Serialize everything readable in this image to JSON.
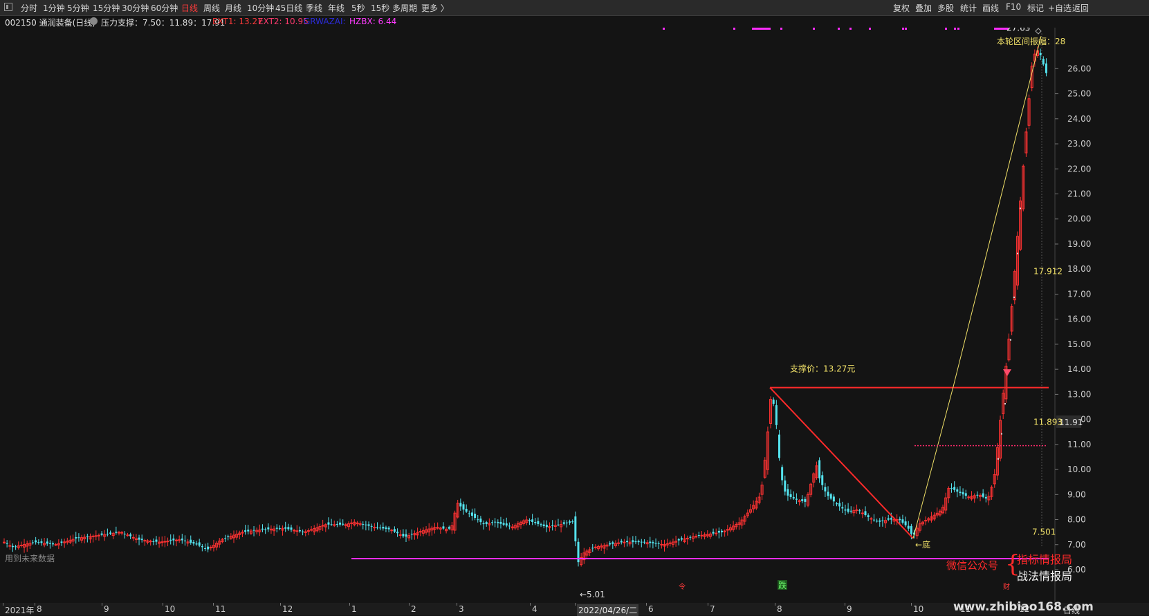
{
  "toolbar": {
    "periods": [
      "分时",
      "1分钟",
      "5分钟",
      "15分钟",
      "30分钟",
      "60分钟",
      "日线",
      "周线",
      "月线",
      "10分钟",
      "45日线",
      "季线",
      "年线",
      "5秒",
      "15秒",
      "多周期",
      "更多 〉"
    ],
    "active_index": 6,
    "right_buttons": [
      "复权",
      "叠加",
      "多股",
      "统计",
      "画线",
      "F10",
      "标记",
      "+自选",
      "返回"
    ]
  },
  "info": {
    "stock": "002150 通润装备(日线)",
    "indicator": "压力支撑：7.50：11.89：17.91",
    "ext1": "EXT1: 13.27",
    "ext2": "EXT2: 10.95",
    "grwaza": "GRWAZAI:",
    "hzbx": "HZBX: 6.44"
  },
  "colors": {
    "up": "#ff3232",
    "down": "#54e3ee",
    "pink": "#ff2cff",
    "yellow": "#f0e068",
    "bg": "#141414"
  },
  "chart_data": {
    "type": "candlestick",
    "y_ticks": [
      "6.00",
      "7.00",
      "8.00",
      "9.00",
      "10.00",
      "11.00",
      "12.00",
      "13.00",
      "14.00",
      "15.00",
      "16.00",
      "17.00",
      "18.00",
      "19.00",
      "20.00",
      "21.00",
      "22.00",
      "23.00",
      "24.00",
      "25.00",
      "26.00"
    ],
    "ylim": [
      6.0,
      27.5
    ],
    "current_price": "11.91",
    "x_labels": [
      "2021年",
      "8",
      "9",
      "10",
      "11",
      "12",
      "1",
      "2",
      "3",
      "4",
      "2022/04/26/二",
      "6",
      "7",
      "8",
      "9",
      "10",
      "11",
      "12"
    ],
    "anchors": [
      [
        0,
        7.2
      ],
      [
        18,
        6.9
      ],
      [
        50,
        7.1
      ],
      [
        80,
        7.0
      ],
      [
        110,
        7.25
      ],
      [
        150,
        7.4
      ],
      [
        175,
        7.5
      ],
      [
        200,
        7.2
      ],
      [
        230,
        7.1
      ],
      [
        260,
        7.2
      ],
      [
        285,
        7.0
      ],
      [
        300,
        6.8
      ],
      [
        320,
        7.2
      ],
      [
        350,
        7.5
      ],
      [
        380,
        7.6
      ],
      [
        410,
        7.65
      ],
      [
        440,
        7.5
      ],
      [
        470,
        7.8
      ],
      [
        500,
        7.8
      ],
      [
        512,
        7.9
      ],
      [
        540,
        7.7
      ],
      [
        565,
        7.6
      ],
      [
        585,
        7.3
      ],
      [
        610,
        7.55
      ],
      [
        630,
        7.7
      ],
      [
        648,
        7.6
      ],
      [
        655,
        7.8
      ],
      [
        660,
        8.7
      ],
      [
        670,
        8.4
      ],
      [
        685,
        8.1
      ],
      [
        700,
        7.8
      ],
      [
        715,
        7.9
      ],
      [
        740,
        7.7
      ],
      [
        760,
        8.0
      ],
      [
        790,
        7.7
      ],
      [
        810,
        7.8
      ],
      [
        828,
        7.9
      ],
      [
        836,
        6.3
      ],
      [
        845,
        6.7
      ],
      [
        860,
        6.9
      ],
      [
        880,
        7.0
      ],
      [
        900,
        7.1
      ],
      [
        930,
        7.1
      ],
      [
        960,
        7.0
      ],
      [
        985,
        7.2
      ],
      [
        1000,
        7.3
      ],
      [
        1020,
        7.4
      ],
      [
        1045,
        7.5
      ],
      [
        1070,
        7.9
      ],
      [
        1085,
        8.4
      ],
      [
        1100,
        9.0
      ],
      [
        1108,
        10.9
      ],
      [
        1115,
        13.1
      ],
      [
        1121,
        12.2
      ],
      [
        1127,
        10.3
      ],
      [
        1131,
        9.5
      ],
      [
        1136,
        9.0
      ],
      [
        1150,
        8.8
      ],
      [
        1165,
        8.7
      ],
      [
        1173,
        9.5
      ],
      [
        1180,
        10.2
      ],
      [
        1185,
        9.6
      ],
      [
        1195,
        9.0
      ],
      [
        1210,
        8.6
      ],
      [
        1225,
        8.3
      ],
      [
        1240,
        8.4
      ],
      [
        1255,
        8.1
      ],
      [
        1270,
        7.9
      ],
      [
        1285,
        8.0
      ],
      [
        1300,
        8.0
      ],
      [
        1312,
        7.7
      ],
      [
        1320,
        7.3
      ],
      [
        1328,
        7.8
      ],
      [
        1340,
        8.0
      ],
      [
        1352,
        8.2
      ],
      [
        1362,
        8.4
      ],
      [
        1372,
        9.3
      ],
      [
        1385,
        9.1
      ],
      [
        1400,
        8.9
      ],
      [
        1415,
        9.0
      ],
      [
        1428,
        8.8
      ],
      [
        1437,
        9.6
      ],
      [
        1460,
        15.6
      ],
      [
        1478,
        21.7
      ],
      [
        1485,
        24.0
      ],
      [
        1492,
        26.2
      ],
      [
        1498,
        26.8
      ],
      [
        1505,
        26.5
      ],
      [
        1512,
        25.8
      ],
      [
        1516,
        26.0
      ]
    ],
    "pressure_support": {
      "levels": [
        7.501,
        11.893,
        17.912
      ],
      "labels": [
        "7.501",
        "11.893",
        "17.912"
      ]
    },
    "support_line": {
      "value": 13.27,
      "label": "支撑价：13.27元"
    },
    "pink_line": 6.44,
    "dotted_line": 10.95,
    "annotations": {
      "low": "←5.01",
      "bottom": "←底",
      "high": "27.65",
      "range_label": "本轮区间振幅：28",
      "warn": "用到未来数据"
    },
    "markers": {
      "die": "跌",
      "small1": "令",
      "small2": "财"
    }
  },
  "watermark": {
    "line1": "微信公众号",
    "line2": "指标情报局",
    "line3": "战法情报局",
    "url": "www.zhibiao168.com",
    "axis_suffix": "日线"
  }
}
